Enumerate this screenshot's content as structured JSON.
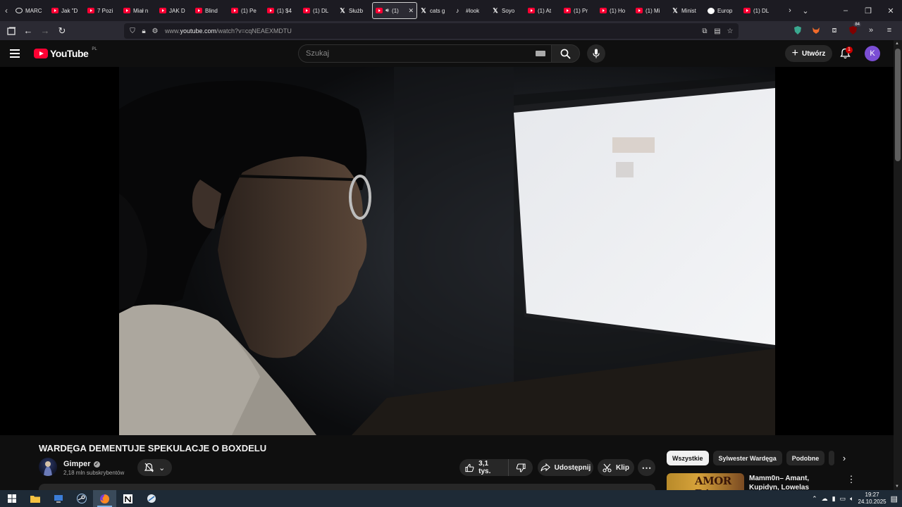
{
  "browser": {
    "tabs": [
      {
        "icon": "ring",
        "label": "MARC"
      },
      {
        "icon": "yt",
        "label": "Jak \"D"
      },
      {
        "icon": "yt",
        "label": "7 Pozi"
      },
      {
        "icon": "yt",
        "label": "Miał n"
      },
      {
        "icon": "yt",
        "label": "JAK D"
      },
      {
        "icon": "yt",
        "label": "Blind"
      },
      {
        "icon": "yt",
        "label": "(1) Pe"
      },
      {
        "icon": "yt",
        "label": "(1) $4"
      },
      {
        "icon": "yt",
        "label": "(1) DL"
      },
      {
        "icon": "x",
        "label": "Służb"
      },
      {
        "icon": "yt",
        "label": "(1)",
        "active": true
      },
      {
        "icon": "x",
        "label": "cats g"
      },
      {
        "icon": "tt",
        "label": "#look"
      },
      {
        "icon": "x",
        "label": "Soyo"
      },
      {
        "icon": "yt",
        "label": "(1) At"
      },
      {
        "icon": "yt",
        "label": "(1) Pr"
      },
      {
        "icon": "yt",
        "label": "(1) Ho"
      },
      {
        "icon": "yt",
        "label": "(1) Mi"
      },
      {
        "icon": "x",
        "label": "Minist"
      },
      {
        "icon": "gl",
        "label": "Europ"
      },
      {
        "icon": "yt",
        "label": "(1) DL"
      }
    ],
    "url_prefix": "www.",
    "url_domain": "youtube.com",
    "url_path": "/watch?v=cqNEAEXMDTU",
    "extension_badge": "84"
  },
  "youtube": {
    "logo_text": "YouTube",
    "country_code": "PL",
    "search_placeholder": "Szukaj",
    "create_label": "Utwórz",
    "notification_count": "1",
    "avatar_letter": "K"
  },
  "video": {
    "title": "WARDĘGA DEMENTUJE SPEKULACJE O BOXDELU",
    "channel_name": "Gimper",
    "subscribers": "2,18 mln subskrybentów",
    "likes": "3,1 tys.",
    "share_label": "Udostępnij",
    "clip_label": "Klip"
  },
  "sidebar": {
    "chips": [
      {
        "label": "Wszystkie",
        "active": true
      },
      {
        "label": "Sylwester Wardęga",
        "active": false
      },
      {
        "label": "Podobne",
        "active": false
      }
    ],
    "recommendation": {
      "thumb_text": "AMOR RA",
      "title": "Mamm0n– Amant, Kupidyn, Lowelas"
    }
  },
  "taskbar": {
    "time": "19:27",
    "date": "24.10.2025"
  },
  "colors": {
    "youtube_red": "#ff0033",
    "background": "#0f0f0f",
    "avatar": "#7b4ed4"
  }
}
